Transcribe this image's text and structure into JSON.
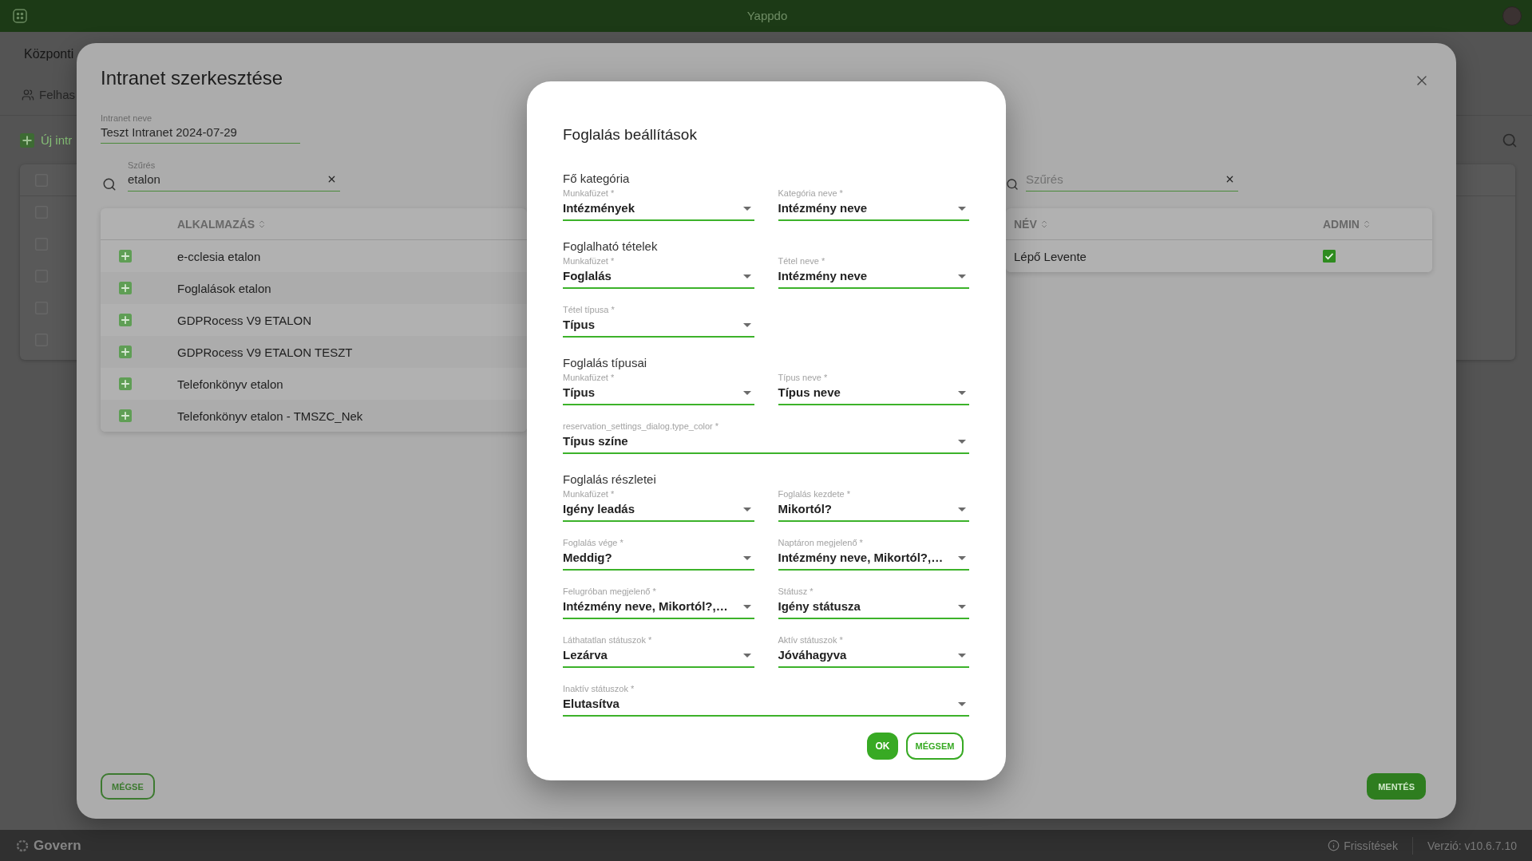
{
  "top_bar": {
    "title": "Yappdo"
  },
  "page": {
    "heading": "Központi",
    "tab": "Felhas",
    "new_button": "Új intr",
    "table": {
      "header_checked": false,
      "rows": [
        {
          "checked": false
        },
        {
          "checked": false
        },
        {
          "checked": false
        },
        {
          "checked": false
        },
        {
          "checked": false
        }
      ]
    }
  },
  "intranet_dialog": {
    "title": "Intranet szerkesztése",
    "name_field": {
      "label": "Intranet neve",
      "value": "Teszt Intranet 2024-07-29"
    },
    "app_filter": {
      "label": "Szűrés",
      "value": "etalon"
    },
    "app_table": {
      "columns": [
        "ALKALMAZÁS"
      ],
      "rows": [
        "e-cclesia etalon",
        "Foglalások etalon",
        "GDPRocess V9 ETALON",
        "GDPRocess V9 ETALON TESZT",
        "Telefonkönyv etalon",
        "Telefonkönyv etalon - TMSZC_Nek"
      ]
    },
    "user_filter": {
      "placeholder": "Szűrés"
    },
    "user_table": {
      "columns": [
        "NÉV",
        "ADMIN"
      ],
      "rows": [
        {
          "name": "Lépő Levente",
          "admin": true
        }
      ]
    },
    "buttons": {
      "cancel": "MÉGSE",
      "save": "MENTÉS"
    }
  },
  "settings_dialog": {
    "title": "Foglalás beállítások",
    "sections": [
      {
        "title": "Fő kategória",
        "fields": [
          {
            "kind": "half",
            "label": "Munkafüzet *",
            "value": "Intézmények"
          },
          {
            "kind": "half",
            "label": "Kategória neve *",
            "value": "Intézmény neve"
          }
        ]
      },
      {
        "title": "Foglalható tételek",
        "fields": [
          {
            "kind": "half",
            "label": "Munkafüzet *",
            "value": "Foglalás"
          },
          {
            "kind": "half",
            "label": "Tétel neve *",
            "value": "Intézmény neve"
          },
          {
            "kind": "half",
            "label": "Tétel típusa *",
            "value": "Típus"
          }
        ]
      },
      {
        "title": "Foglalás típusai",
        "fields": [
          {
            "kind": "half",
            "label": "Munkafüzet *",
            "value": "Típus"
          },
          {
            "kind": "half",
            "label": "Típus neve *",
            "value": "Típus neve"
          },
          {
            "kind": "full",
            "label": "reservation_settings_dialog.type_color *",
            "value": "Típus színe"
          }
        ]
      },
      {
        "title": "Foglalás részletei",
        "fields": [
          {
            "kind": "half",
            "label": "Munkafüzet *",
            "value": "Igény leadás"
          },
          {
            "kind": "half",
            "label": "Foglalás kezdete *",
            "value": "Mikortól?"
          },
          {
            "kind": "half",
            "label": "Foglalás vége *",
            "value": "Meddig?"
          },
          {
            "kind": "half",
            "label": "Naptáron megjelenő *",
            "value": "Intézmény neve, Mikortól?,…"
          },
          {
            "kind": "half",
            "label": "Felugróban megjelenő *",
            "value": "Intézmény neve, Mikortól?,…"
          },
          {
            "kind": "half",
            "label": "Státusz *",
            "value": "Igény státusza"
          },
          {
            "kind": "half",
            "label": "Láthatatlan státuszok *",
            "value": "Lezárva"
          },
          {
            "kind": "half",
            "label": "Aktív státuszok *",
            "value": "Jóváhagyva"
          },
          {
            "kind": "full",
            "label": "Inaktív státuszok *",
            "value": "Elutasítva"
          }
        ]
      }
    ],
    "buttons": {
      "ok": "OK",
      "cancel": "MÉGSEM"
    }
  },
  "footer": {
    "brand": "Govern",
    "updates": "Frissítések",
    "version": "Verzió: v10.6.7.10"
  }
}
